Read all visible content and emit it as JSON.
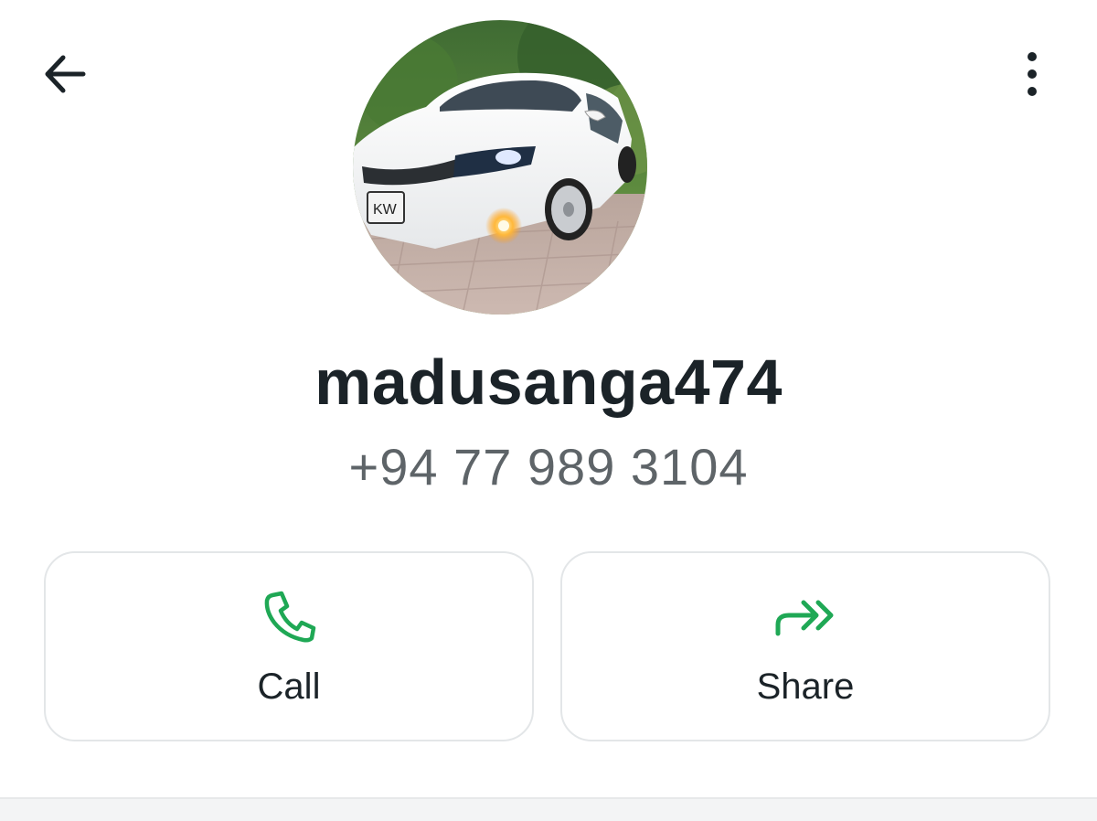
{
  "header": {
    "back_icon": "arrow-left-icon",
    "menu_icon": "more-vertical-icon"
  },
  "profile": {
    "name": "madusanga474",
    "phone": "+94 77 989 3104",
    "photo_description": "white sedan car profile photo"
  },
  "actions": [
    {
      "label": "Call",
      "icon": "phone-icon"
    },
    {
      "label": "Share",
      "icon": "share-forward-icon"
    }
  ],
  "colors": {
    "accent_green": "#1fa855",
    "text_primary": "#1b2328",
    "text_secondary": "#5e6468",
    "card_border": "#e3e6e8"
  }
}
